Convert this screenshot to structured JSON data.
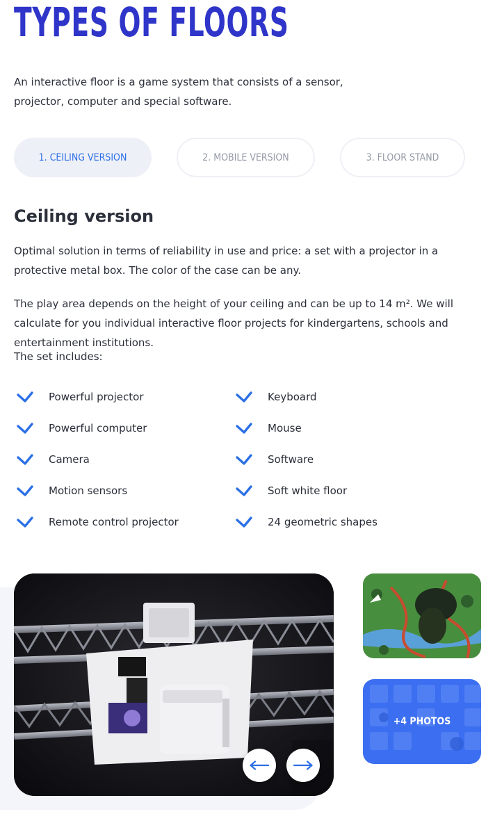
{
  "header": {
    "title": "TYPES OF FLOORS"
  },
  "intro": "An interactive floor is a game system that consists of a sensor, projector, computer and special software.",
  "tabs": [
    {
      "label": "1. CEILING VERSION",
      "active": true
    },
    {
      "label": "2. MOBILE VERSION",
      "active": false
    },
    {
      "label": "3. FLOOR STAND",
      "active": false
    }
  ],
  "section": {
    "title": "Ceiling version",
    "paragraph1": "Optimal solution in terms of reliability in use and price: a set with a projector in a protective metal box. The color of the case can be any.",
    "paragraph2": "The play area depends on the height of your ceiling and can be up to 14 m². We will calculate for you individual interactive floor projects for kindergartens, schools and entertainment institutions.",
    "includes_label": "The set includes:"
  },
  "features_left": [
    "Powerful projector",
    "Powerful computer",
    "Camera",
    "Motion sensors",
    "Remote control projector"
  ],
  "features_right": [
    "Keyboard",
    "Mouse",
    "Software",
    "Soft white floor",
    "24 geometric shapes"
  ],
  "gallery": {
    "more_photos_label": "+4 PHOTOS",
    "prev_icon": "arrow-left-icon",
    "next_icon": "arrow-right-icon"
  },
  "colors": {
    "title": "#2f35c9",
    "accent": "#2c70e6",
    "text": "#2b2f3a",
    "tab_inactive": "#9499a6"
  }
}
